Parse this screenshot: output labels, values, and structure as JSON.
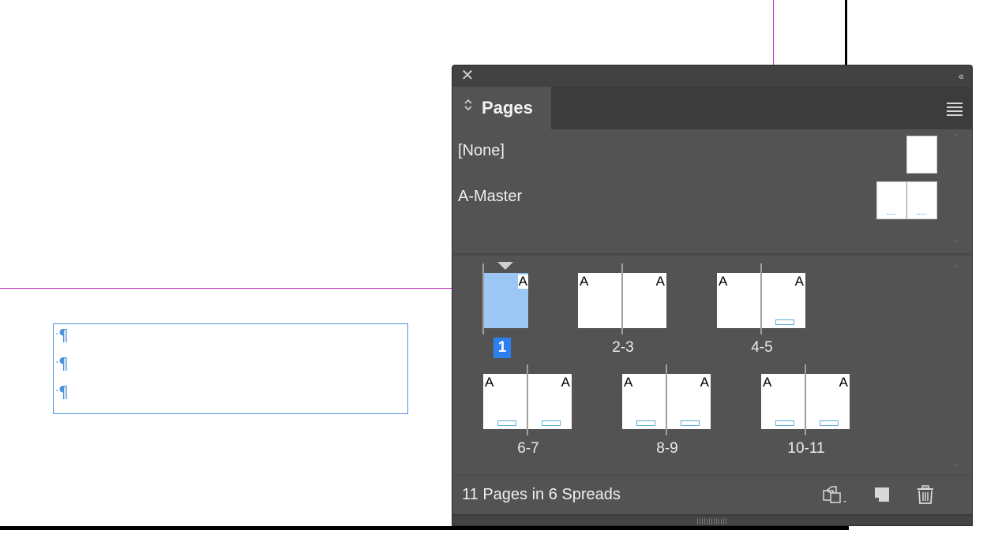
{
  "panel": {
    "close_glyph": "✕",
    "collapse_glyph": "‹‹",
    "tab_label": "Pages",
    "tab_arrows": "⌃⌄",
    "menu_icon": "panel-menu-icon"
  },
  "masters": {
    "none_label": "[None]",
    "a_master_label": "A-Master"
  },
  "spreads": [
    {
      "label": "1",
      "current": true,
      "master_letters": [
        "A"
      ]
    },
    {
      "label": "2-3",
      "master_letters": [
        "A",
        "A"
      ]
    },
    {
      "label": "4-5",
      "master_letters": [
        "A",
        "A"
      ]
    },
    {
      "label": "6-7",
      "master_letters": [
        "A",
        "A"
      ]
    },
    {
      "label": "8-9",
      "master_letters": [
        "A",
        "A"
      ]
    },
    {
      "label": "10-11",
      "master_letters": [
        "A",
        "A"
      ]
    }
  ],
  "footer": {
    "status": "11 Pages in 6 Spreads",
    "icons": [
      "page-size-icon",
      "new-page-icon",
      "trash-icon"
    ]
  },
  "canvas": {
    "pilcrow": "¶"
  },
  "colors": {
    "panel_bg": "#535353",
    "selection_blue": "#2e7ff0",
    "selected_page": "#9cc7f4",
    "guide_magenta": "#c42fc4",
    "frame_blue": "#4f8fe0"
  }
}
